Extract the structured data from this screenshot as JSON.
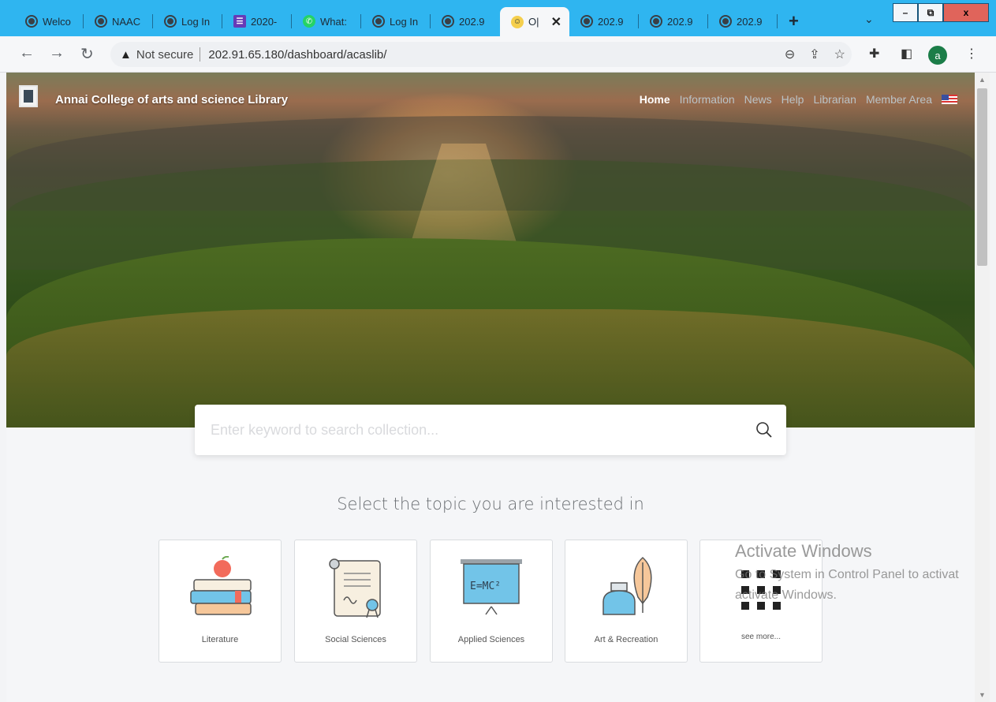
{
  "browser": {
    "tabs": [
      {
        "title": "Welco",
        "icon": "globe-icon"
      },
      {
        "title": "NAAC",
        "icon": "globe-icon"
      },
      {
        "title": "Log In",
        "icon": "globe-icon"
      },
      {
        "title": "2020-",
        "icon": "form-icon"
      },
      {
        "title": "What:",
        "icon": "whatsapp-icon"
      },
      {
        "title": "Log In",
        "icon": "globe-icon"
      },
      {
        "title": "202.9",
        "icon": "globe-icon"
      },
      {
        "title": "O|",
        "icon": "smile-icon",
        "active": true
      },
      {
        "title": "202.9",
        "icon": "globe-icon"
      },
      {
        "title": "202.9",
        "icon": "globe-icon"
      },
      {
        "title": "202.9",
        "icon": "globe-icon"
      }
    ],
    "new_tab": "+",
    "window": {
      "minimize": "–",
      "restore": "⧉",
      "close": "x"
    },
    "security_label": "Not secure",
    "url": "202.91.65.180/dashboard/acaslib/",
    "profile_initial": "a"
  },
  "site": {
    "title": "Annai College of arts and science Library",
    "nav": [
      "Home",
      "Information",
      "News",
      "Help",
      "Librarian",
      "Member Area"
    ],
    "active_nav": "Home"
  },
  "search": {
    "placeholder": "Enter keyword to search collection..."
  },
  "topics": {
    "heading": "Select the topic you are interested in",
    "cards": [
      {
        "label": "Literature",
        "icon": "books-apple-icon"
      },
      {
        "label": "Social Sciences",
        "icon": "scroll-certificate-icon"
      },
      {
        "label": "Applied Sciences",
        "icon": "emc2-board-icon"
      },
      {
        "label": "Art & Recreation",
        "icon": "inkwell-feather-icon"
      },
      {
        "label": "see more...",
        "icon": "grid-icon"
      }
    ]
  },
  "watermark": {
    "title": "Activate Windows",
    "line1": "Go to System in Control Panel to activat",
    "line2": "activate Windows."
  },
  "colors": {
    "tabstrip": "#2fb5f0",
    "profile": "#1b7d48"
  }
}
